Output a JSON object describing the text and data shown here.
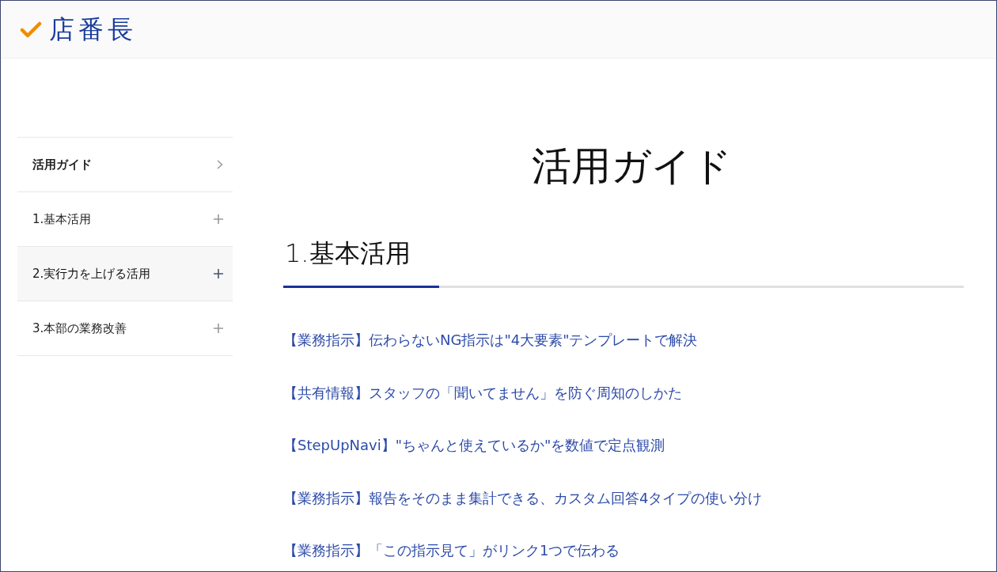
{
  "header": {
    "logo_text": "店番長"
  },
  "sidebar": {
    "items": [
      {
        "label": "活用ガイド",
        "kind": "link",
        "highlighted": false
      },
      {
        "label": "1.基本活用",
        "kind": "section",
        "expanded": false,
        "highlighted": false
      },
      {
        "label": "2.実行力を上げる活用",
        "kind": "section",
        "expanded": false,
        "highlighted": true
      },
      {
        "label": "3.本部の業務改善",
        "kind": "section",
        "expanded": false,
        "highlighted": false
      }
    ]
  },
  "main": {
    "title": "活用ガイド",
    "section": {
      "heading": "1.基本活用",
      "articles": [
        "【業務指示】伝わらないNG指示は\"4大要素\"テンプレートで解決",
        "【共有情報】スタッフの「聞いてません」を防ぐ周知のしかた",
        "【StepUpNavi】\"ちゃんと使えているか\"を数値で定点観測",
        "【業務指示】報告をそのまま集計できる、カスタム回答4タイプの使い分け",
        "【業務指示】「この指示見て」がリンク1つで伝わる"
      ]
    }
  }
}
